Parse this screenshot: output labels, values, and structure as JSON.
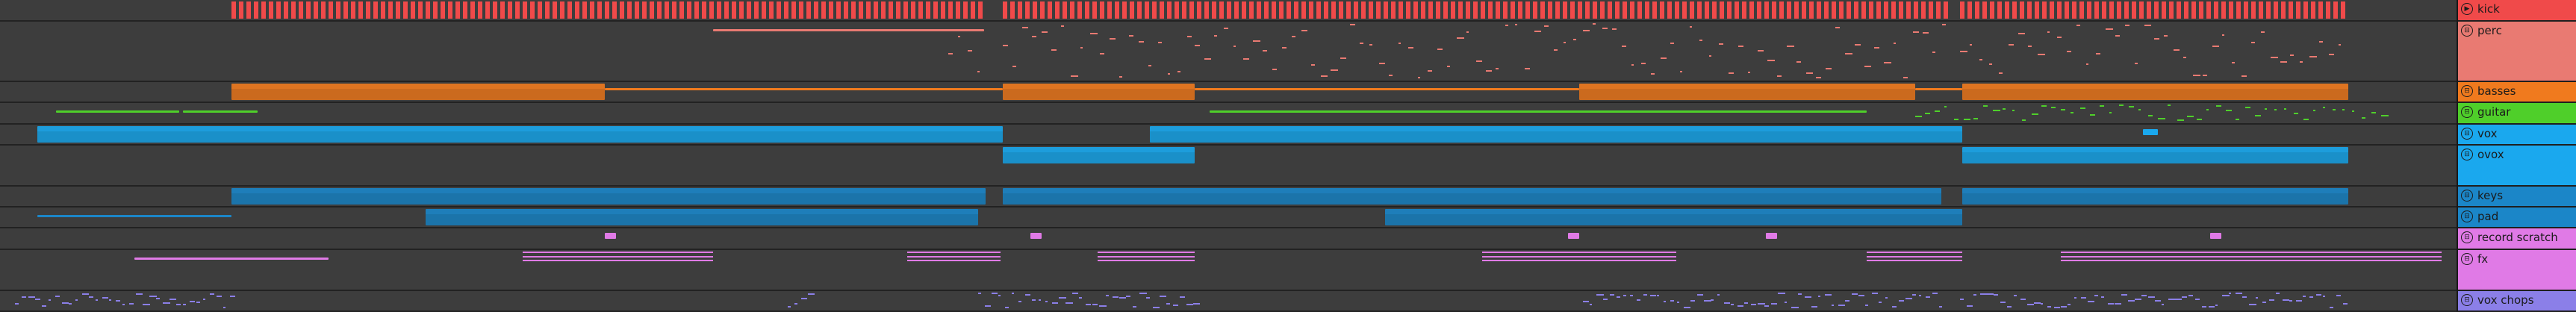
{
  "tracks": [
    {
      "id": "kick",
      "name": "kick",
      "color": "#f04a4a",
      "icon": "play-icon",
      "glyph": "▶"
    },
    {
      "id": "perc",
      "name": "perc",
      "color": "#e97a72",
      "icon": "group-icon",
      "glyph": "⊟"
    },
    {
      "id": "basses",
      "name": "basses",
      "color": "#f07a1e",
      "icon": "group-icon",
      "glyph": "⊟"
    },
    {
      "id": "guitar",
      "name": "guitar",
      "color": "#4fcf2a",
      "icon": "group-icon",
      "glyph": "⊟"
    },
    {
      "id": "vox",
      "name": "vox",
      "color": "#1aa8ee",
      "icon": "group-icon",
      "glyph": "⊟"
    },
    {
      "id": "ovox",
      "name": "ovox",
      "color": "#1aa8ee",
      "icon": "group-icon",
      "glyph": "⊟"
    },
    {
      "id": "keys",
      "name": "keys",
      "color": "#1b86c8",
      "icon": "group-icon",
      "glyph": "⊟"
    },
    {
      "id": "pad",
      "name": "pad",
      "color": "#1b86c8",
      "icon": "group-icon",
      "glyph": "⊟"
    },
    {
      "id": "record-scratch",
      "name": "record scratch",
      "color": "#e07ae6",
      "icon": "group-icon",
      "glyph": "⊟"
    },
    {
      "id": "fx",
      "name": "fx",
      "color": "#e07ae6",
      "icon": "group-icon",
      "glyph": "⊟"
    },
    {
      "id": "vox-chops",
      "name": "vox chops",
      "color": "#8b7fe8",
      "icon": "group-icon",
      "glyph": "⊟"
    }
  ]
}
